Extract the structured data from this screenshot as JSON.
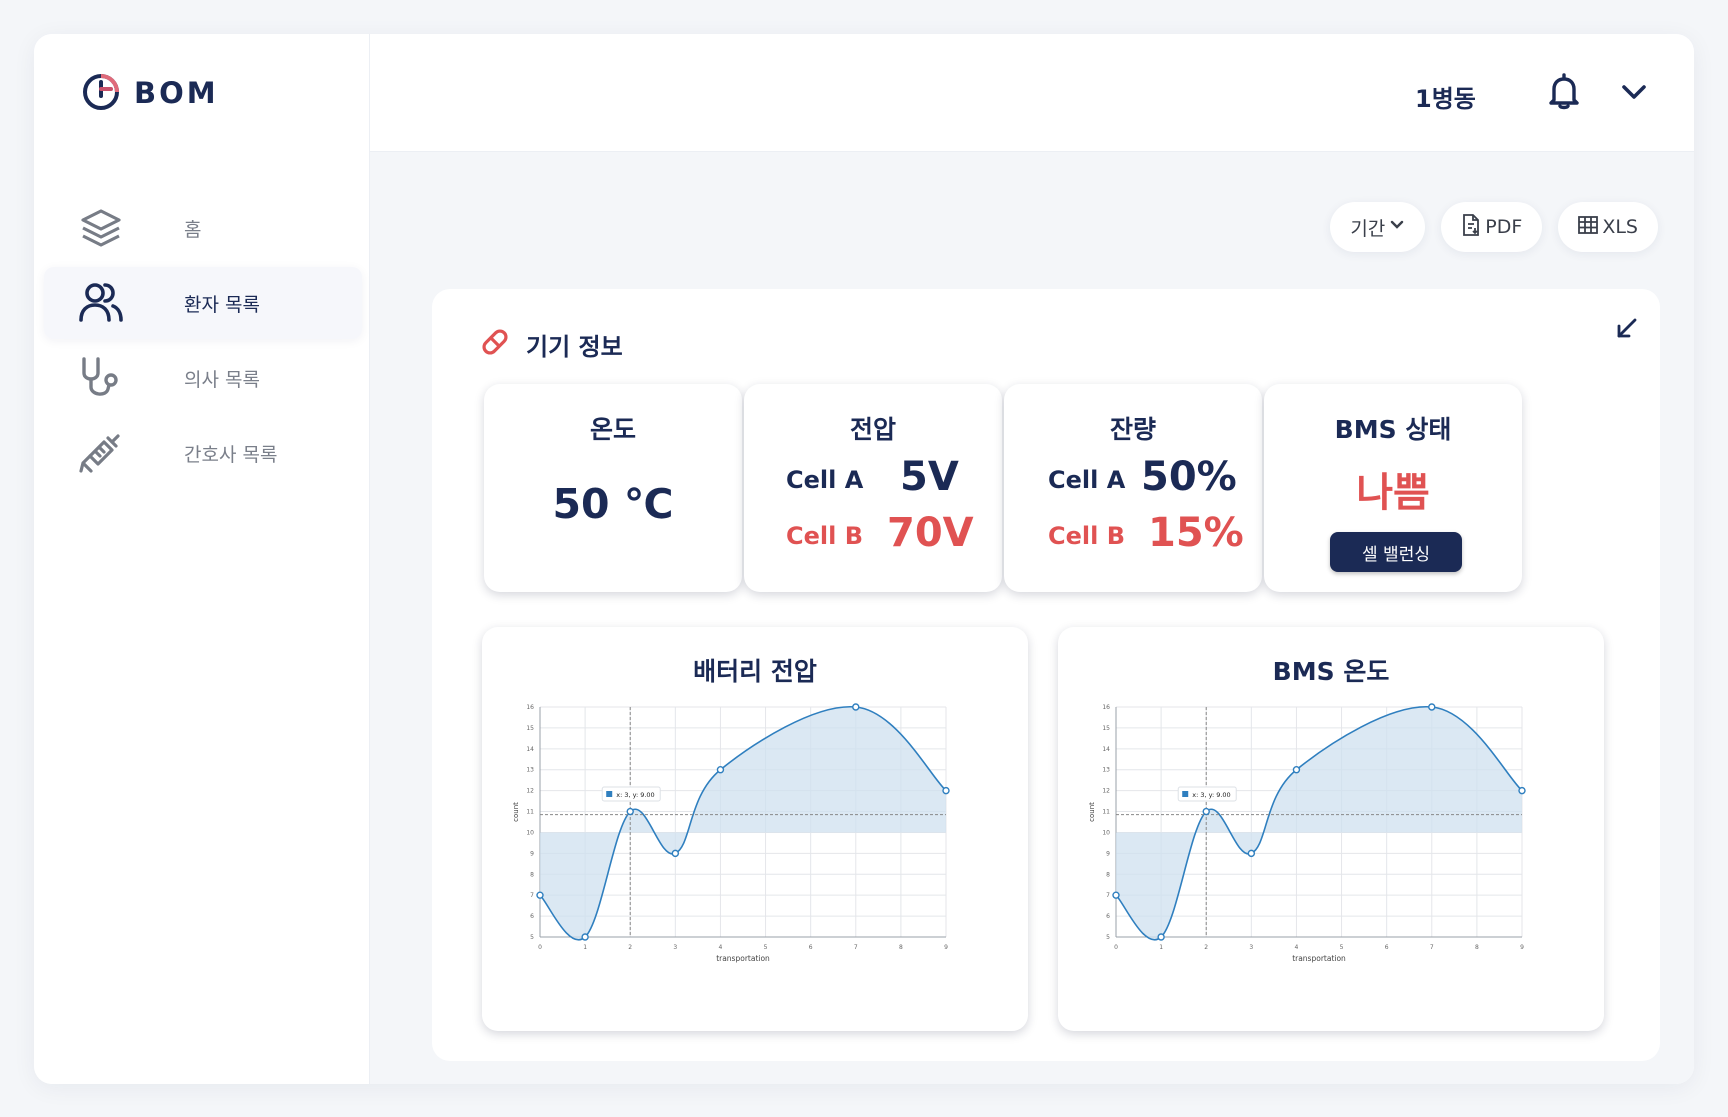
{
  "app": {
    "logo_text": "BOM"
  },
  "sidebar": {
    "items": [
      {
        "label": "홈",
        "icon": "layers-icon",
        "active": false
      },
      {
        "label": "환자 목록",
        "icon": "users-icon",
        "active": true
      },
      {
        "label": "의사 목록",
        "icon": "stethoscope-icon",
        "active": false
      },
      {
        "label": "간호사 목록",
        "icon": "syringe-icon",
        "active": false
      }
    ]
  },
  "header": {
    "ward": "1병동",
    "bell_icon": "bell-icon",
    "menu_icon": "chevron-down-icon"
  },
  "toolbar": {
    "period_label": "기간",
    "pdf_label": "PDF",
    "xls_label": "XLS"
  },
  "panel": {
    "title": "기기 정보",
    "title_icon": "pill-icon",
    "collapse_icon": "arrow-down-left-icon",
    "cards": {
      "temperature": {
        "title": "온도",
        "value": "50 ℃"
      },
      "voltage": {
        "title": "전압",
        "cell_a_label": "Cell A",
        "cell_a_value": "5V",
        "cell_b_label": "Cell B",
        "cell_b_value": "70V"
      },
      "remaining": {
        "title": "잔량",
        "cell_a_label": "Cell A",
        "cell_a_value": "50%",
        "cell_b_label": "Cell B",
        "cell_b_value": "15%"
      },
      "bms": {
        "title": "BMS 상태",
        "status": "나쁨",
        "button_label": "셀 밸런싱"
      }
    }
  },
  "colors": {
    "navy": "#1b2a55",
    "red": "#e05252",
    "accent_line": "#2f7fbf",
    "fill": "#cfe0ef"
  },
  "chart_data": [
    {
      "type": "area",
      "title": "배터리 전압",
      "xlabel": "transportation",
      "ylabel": "count",
      "x": [
        0,
        1,
        2,
        3,
        4,
        5,
        6,
        7,
        8,
        9
      ],
      "y": [
        7,
        5,
        11,
        9,
        13,
        null,
        null,
        16,
        null,
        12
      ],
      "xlim": [
        0,
        9
      ],
      "ylim": [
        5,
        16
      ],
      "baseline": 10,
      "tooltip": {
        "x_label": "x:",
        "x_value": "3",
        "y_label": "y:",
        "y_value": "9.00"
      },
      "grid": true
    },
    {
      "type": "area",
      "title": "BMS 온도",
      "xlabel": "transportation",
      "ylabel": "count",
      "x": [
        0,
        1,
        2,
        3,
        4,
        5,
        6,
        7,
        8,
        9
      ],
      "y": [
        7,
        5,
        11,
        9,
        13,
        null,
        null,
        16,
        null,
        12
      ],
      "xlim": [
        0,
        9
      ],
      "ylim": [
        5,
        16
      ],
      "baseline": 10,
      "tooltip": {
        "x_label": "x:",
        "x_value": "3",
        "y_label": "y:",
        "y_value": "9.00"
      },
      "grid": true
    }
  ]
}
